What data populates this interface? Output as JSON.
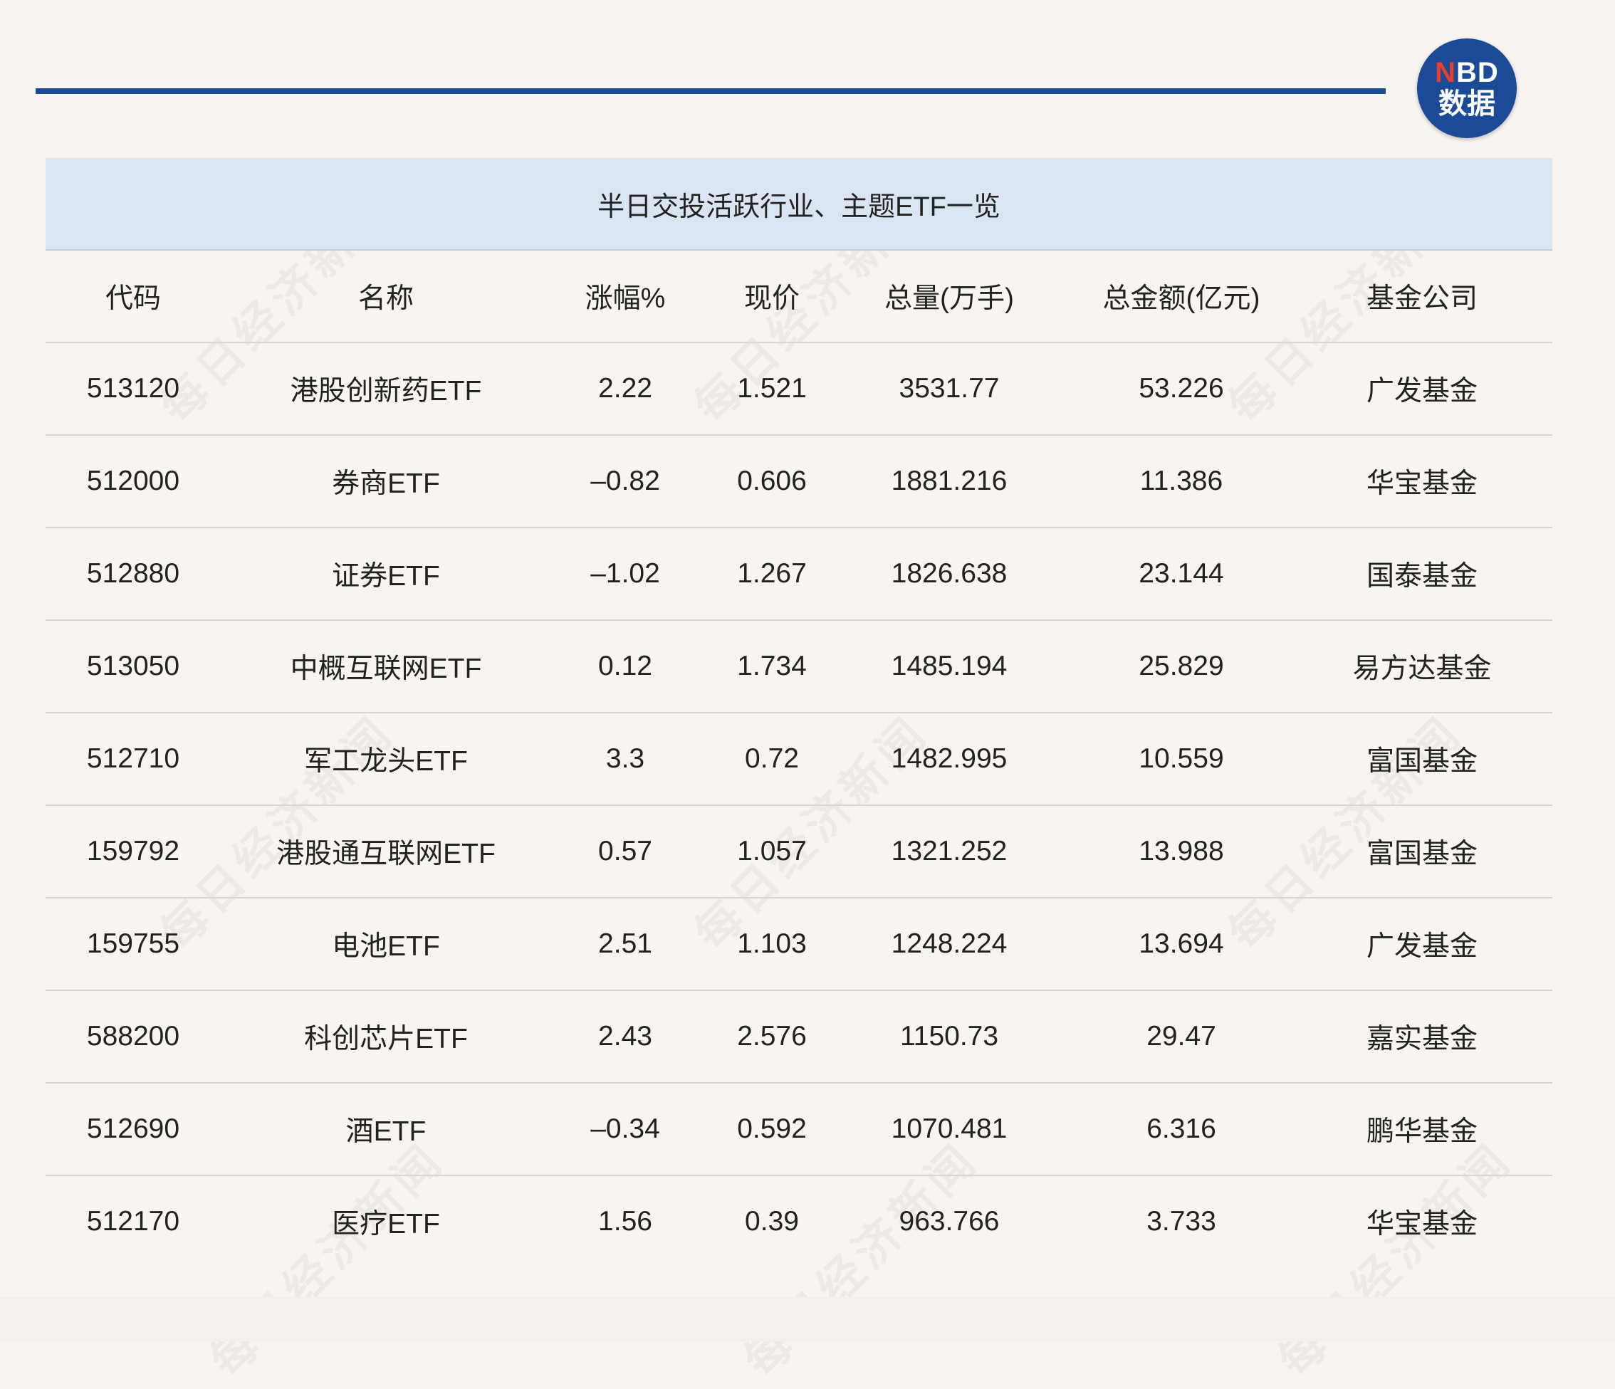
{
  "logo": {
    "top_accent": "N",
    "top_rest": "BD",
    "bottom": "数据"
  },
  "watermark": "每日经济新闻",
  "table": {
    "title": "半日交投活跃行业、主题ETF一览",
    "headers": [
      "代码",
      "名称",
      "涨幅%",
      "现价",
      "总量(万手)",
      "总金额(亿元)",
      "基金公司"
    ],
    "rows": [
      [
        "513120",
        "港股创新药ETF",
        "2.22",
        "1.521",
        "3531.77",
        "53.226",
        "广发基金"
      ],
      [
        "512000",
        "券商ETF",
        "–0.82",
        "0.606",
        "1881.216",
        "11.386",
        "华宝基金"
      ],
      [
        "512880",
        "证券ETF",
        "–1.02",
        "1.267",
        "1826.638",
        "23.144",
        "国泰基金"
      ],
      [
        "513050",
        "中概互联网ETF",
        "0.12",
        "1.734",
        "1485.194",
        "25.829",
        "易方达基金"
      ],
      [
        "512710",
        "军工龙头ETF",
        "3.3",
        "0.72",
        "1482.995",
        "10.559",
        "富国基金"
      ],
      [
        "159792",
        "港股通互联网ETF",
        "0.57",
        "1.057",
        "1321.252",
        "13.988",
        "富国基金"
      ],
      [
        "159755",
        "电池ETF",
        "2.51",
        "1.103",
        "1248.224",
        "13.694",
        "广发基金"
      ],
      [
        "588200",
        "科创芯片ETF",
        "2.43",
        "2.576",
        "1150.73",
        "29.47",
        "嘉实基金"
      ],
      [
        "512690",
        "酒ETF",
        "–0.34",
        "0.592",
        "1070.481",
        "6.316",
        "鹏华基金"
      ],
      [
        "512170",
        "医疗ETF",
        "1.56",
        "0.39",
        "963.766",
        "3.733",
        "华宝基金"
      ]
    ]
  }
}
